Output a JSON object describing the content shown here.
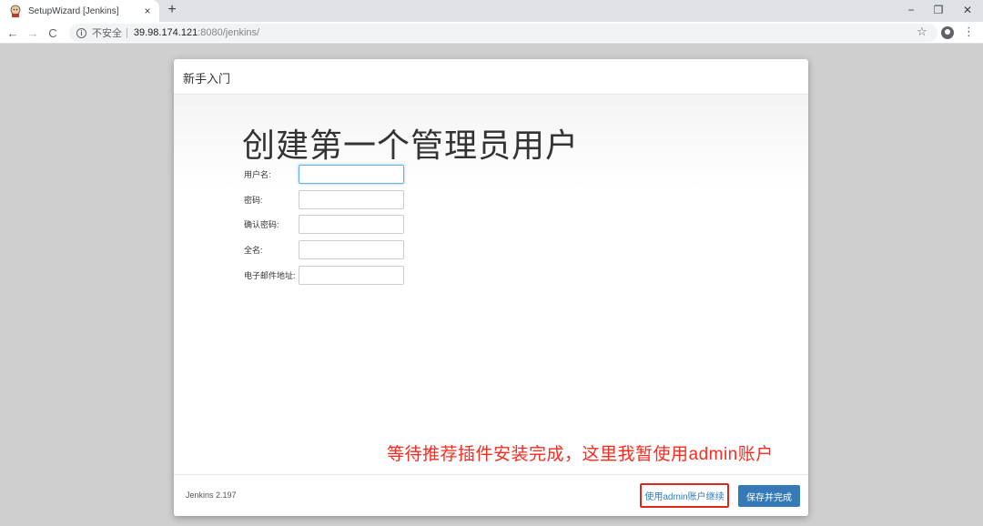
{
  "browser": {
    "tab_title": "SetupWizard [Jenkins]",
    "tab_close": "×",
    "new_tab": "+",
    "nav_back": "←",
    "nav_forward": "→",
    "nav_reload": "C",
    "security_label": "不安全",
    "url_host": "39.98.174.121",
    "url_rest": ":8080/jenkins/",
    "star": "☆",
    "menu": "⋮",
    "win_minimize": "−",
    "win_maximize": "❐",
    "win_close": "✕"
  },
  "dialog": {
    "header_title": "新手入门",
    "main_title": "创建第一个管理员用户",
    "fields": [
      {
        "label": "用户名:",
        "value": ""
      },
      {
        "label": "密码:",
        "value": ""
      },
      {
        "label": "确认密码:",
        "value": ""
      },
      {
        "label": "全名:",
        "value": ""
      },
      {
        "label": "电子邮件地址:",
        "value": ""
      }
    ],
    "annotation": "等待推荐插件安装完成，这里我暂使用admin账户",
    "footer": {
      "version": "Jenkins 2.197",
      "continue_admin_label": "使用admin账户继续",
      "save_finish_label": "保存并完成"
    }
  },
  "colors": {
    "primary": "#337ab7",
    "annotation_red": "#ff2a1f",
    "highlight_border": "#e0261b",
    "page_bg": "#cfcfcf"
  }
}
